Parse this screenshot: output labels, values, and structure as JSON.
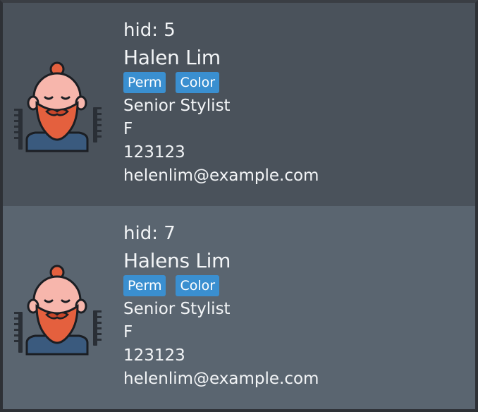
{
  "people": [
    {
      "hid_text": "hid: 5",
      "name": "Halen Lim",
      "tags": [
        "Perm",
        "Color"
      ],
      "title": "Senior Stylist",
      "gender": "F",
      "phone": "123123",
      "email": "helenlim@example.com",
      "avatar_icon": "bearded-man-avatar-icon"
    },
    {
      "hid_text": "hid: 7",
      "name": "Halens Lim",
      "tags": [
        "Perm",
        "Color"
      ],
      "title": "Senior Stylist",
      "gender": "F",
      "phone": "123123",
      "email": "helenlim@example.com",
      "avatar_icon": "bearded-man-avatar-icon"
    }
  ],
  "colors": {
    "card_dark": "#4a525b",
    "card_light": "#5a6570",
    "tag_bg": "#3a8fd0",
    "text": "#f3f5f7"
  }
}
